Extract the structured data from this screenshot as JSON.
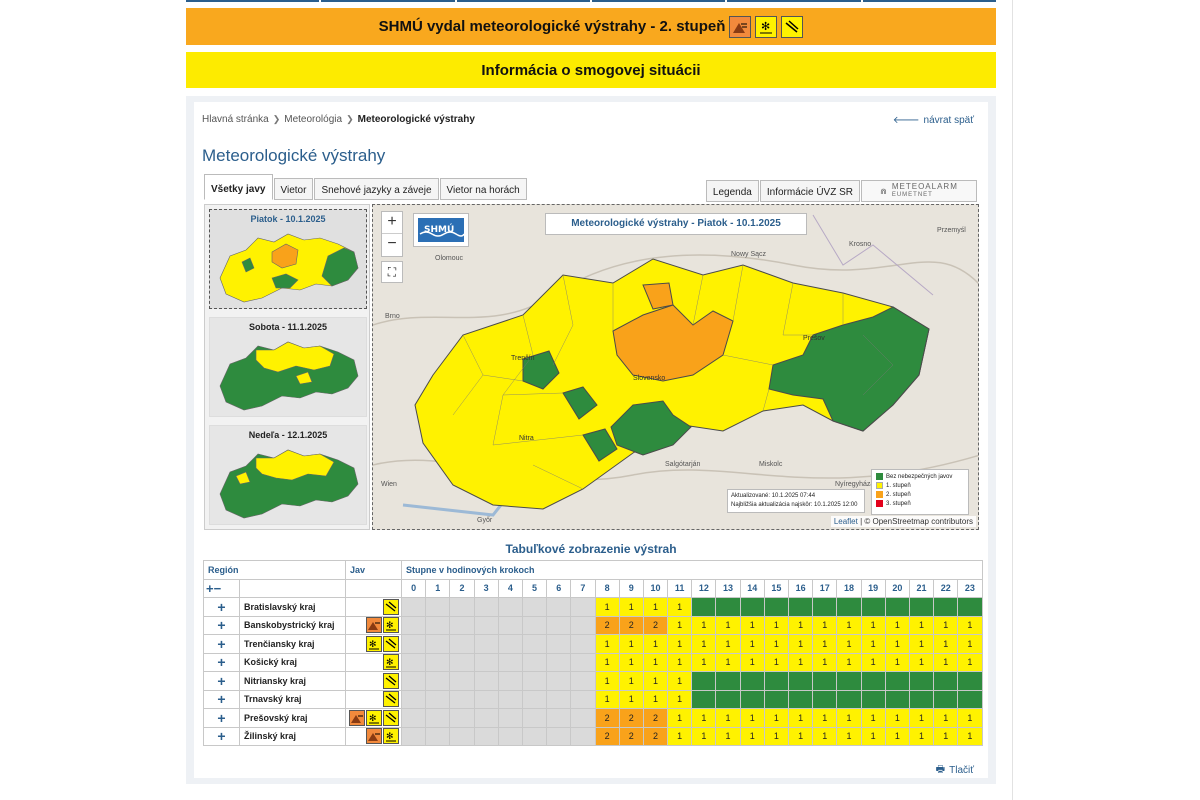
{
  "banners": {
    "warning": "SHMÚ vydal meteorologické výstrahy - 2. stupeň",
    "smog": "Informácia o smogovej situácii"
  },
  "breadcrumb": [
    "Hlavná stránka",
    "Meteorológia",
    "Meteorologické výstrahy"
  ],
  "back_label": "návrat späť",
  "page_title": "Meteorologické výstrahy",
  "tabs": [
    "Všetky javy",
    "Vietor",
    "Snehové jazyky a záveje",
    "Vietor na horách"
  ],
  "right_tabs": [
    "Legenda",
    "Informácie ÚVZ SR"
  ],
  "meteoalarm": {
    "top": "METEOALARM",
    "sub": "EUMETNET"
  },
  "days": [
    "Piatok - 10.1.2025",
    "Sobota - 11.1.2025",
    "Nedeľa - 12.1.2025"
  ],
  "map": {
    "title": "Meteorologické výstrahy - Piatok - 10.1.2025",
    "logo": "SHMÚ",
    "zoom_in": "+",
    "zoom_out": "−",
    "updated": "Aktualizované: 10.1.2025 07:44",
    "next_update": "Najbližšia aktualizácia najskôr: 10.1.2025 12:00",
    "legend": [
      "Bez nebezpečných javov",
      "1. stupeň",
      "2. stupeň",
      "3. stupeň"
    ],
    "attribution_leaflet": "Leaflet",
    "attribution_rest": "| © OpenStreetmap contributors",
    "places": [
      "Olomouc",
      "Brno",
      "Nowy Sącz",
      "Krosno",
      "Przemyśl",
      "Trenčín",
      "Slovensko",
      "Nitra",
      "Prešov",
      "Wien",
      "Győr",
      "Salgótarján",
      "Miskolc",
      "Nyíregyháza"
    ]
  },
  "colors": {
    "none": "#2e8b3e",
    "level1": "#fff200",
    "level2": "#f9a21a",
    "level3": "#e3001b",
    "na": "#dadada"
  },
  "table": {
    "title": "Tabuľkové zobrazenie výstrah",
    "col_region": "Región",
    "col_phenomenon": "Jav",
    "col_steps": "Stupne v hodinových krokoch",
    "expand_all": "+",
    "collapse_all": "−",
    "hours": [
      "0",
      "1",
      "2",
      "3",
      "4",
      "5",
      "6",
      "7",
      "8",
      "9",
      "10",
      "11",
      "12",
      "13",
      "14",
      "15",
      "16",
      "17",
      "18",
      "19",
      "20",
      "21",
      "22",
      "23"
    ],
    "rows": [
      {
        "region": "Bratislavský kraj",
        "icons": [
          "wind"
        ],
        "levels": [
          0,
          0,
          0,
          0,
          0,
          0,
          0,
          0,
          1,
          1,
          1,
          1,
          "g",
          "g",
          "g",
          "g",
          "g",
          "g",
          "g",
          "g",
          "g",
          "g",
          "g",
          "g"
        ]
      },
      {
        "region": "Banskobystrický kraj",
        "icons": [
          "mountain-wind",
          "snow-drift"
        ],
        "levels": [
          0,
          0,
          0,
          0,
          0,
          0,
          0,
          0,
          2,
          2,
          2,
          1,
          1,
          1,
          1,
          1,
          1,
          1,
          1,
          1,
          1,
          1,
          1,
          1
        ]
      },
      {
        "region": "Trenčiansky kraj",
        "icons": [
          "snow-drift",
          "wind"
        ],
        "levels": [
          0,
          0,
          0,
          0,
          0,
          0,
          0,
          0,
          1,
          1,
          1,
          1,
          1,
          1,
          1,
          1,
          1,
          1,
          1,
          1,
          1,
          1,
          1,
          1
        ]
      },
      {
        "region": "Košický kraj",
        "icons": [
          "snow-drift"
        ],
        "levels": [
          0,
          0,
          0,
          0,
          0,
          0,
          0,
          0,
          1,
          1,
          1,
          1,
          1,
          1,
          1,
          1,
          1,
          1,
          1,
          1,
          1,
          1,
          1,
          1
        ]
      },
      {
        "region": "Nitriansky kraj",
        "icons": [
          "wind"
        ],
        "levels": [
          0,
          0,
          0,
          0,
          0,
          0,
          0,
          0,
          1,
          1,
          1,
          1,
          "g",
          "g",
          "g",
          "g",
          "g",
          "g",
          "g",
          "g",
          "g",
          "g",
          "g",
          "g"
        ]
      },
      {
        "region": "Trnavský kraj",
        "icons": [
          "wind"
        ],
        "levels": [
          0,
          0,
          0,
          0,
          0,
          0,
          0,
          0,
          1,
          1,
          1,
          1,
          "g",
          "g",
          "g",
          "g",
          "g",
          "g",
          "g",
          "g",
          "g",
          "g",
          "g",
          "g"
        ]
      },
      {
        "region": "Prešovský kraj",
        "icons": [
          "mountain-wind",
          "snow-drift",
          "wind"
        ],
        "levels": [
          0,
          0,
          0,
          0,
          0,
          0,
          0,
          0,
          2,
          2,
          2,
          1,
          1,
          1,
          1,
          1,
          1,
          1,
          1,
          1,
          1,
          1,
          1,
          1
        ]
      },
      {
        "region": "Žilinský kraj",
        "icons": [
          "mountain-wind",
          "snow-drift"
        ],
        "levels": [
          0,
          0,
          0,
          0,
          0,
          0,
          0,
          0,
          2,
          2,
          2,
          1,
          1,
          1,
          1,
          1,
          1,
          1,
          1,
          1,
          1,
          1,
          1,
          1
        ]
      }
    ]
  },
  "print_label": "Tlačiť"
}
